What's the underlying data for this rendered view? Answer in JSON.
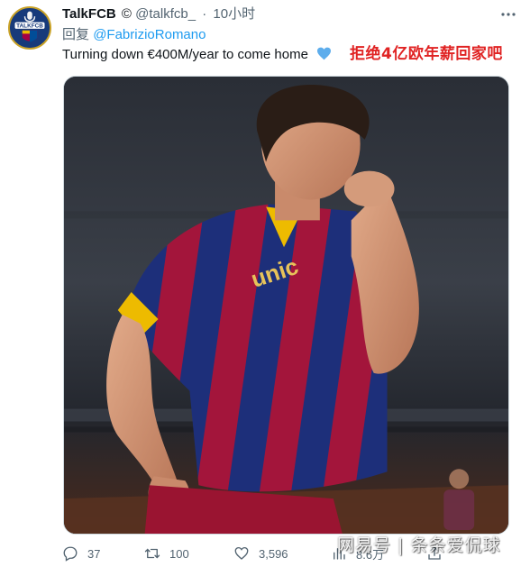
{
  "tweet": {
    "display_name": "TalkFCB",
    "copyright_glyph": "©",
    "handle": "@talkfcb_",
    "separator": "·",
    "time": "10小时",
    "reply_prefix": "回复",
    "reply_to": "@FabrizioRomano",
    "text": "Turning down €400M/year to come home",
    "emoji": "blue-heart-emoji"
  },
  "avatar": {
    "label": "TALKFCB",
    "icon": "talkfcb-crest-logo"
  },
  "caption_overlay": "拒绝4亿欧年薪回家吧",
  "media": {
    "kind": "photo",
    "subject": "player-kissing-jersey"
  },
  "actions": {
    "replies": {
      "icon": "reply-icon",
      "count": "37"
    },
    "retweets": {
      "icon": "retweet-icon",
      "count": "100"
    },
    "likes": {
      "icon": "like-icon",
      "count": "3,596"
    },
    "views": {
      "icon": "views-icon",
      "count": "8.6万"
    },
    "share": {
      "icon": "share-icon"
    }
  },
  "watermark": "网易号 | 条条爱侃球",
  "colors": {
    "link": "#1d9bf0",
    "muted": "#536471",
    "caption": "#e02323",
    "crest_blue": "#173a7a"
  }
}
